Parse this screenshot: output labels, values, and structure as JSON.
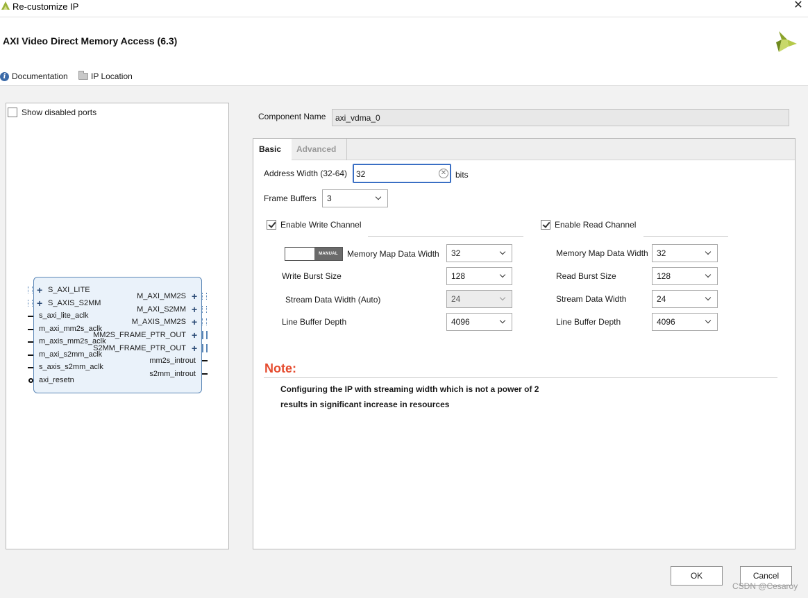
{
  "window": {
    "title": "Re-customize IP",
    "close_glyph": "✕"
  },
  "header": {
    "ip_title": "AXI Video Direct Memory Access (6.3)",
    "doc_label": "Documentation",
    "ip_location_label": "IP Location",
    "info_glyph": "i"
  },
  "left_panel": {
    "show_disabled_label": "Show disabled ports",
    "show_disabled_checked": false,
    "block": {
      "left_ports": [
        "S_AXI_LITE",
        "S_AXIS_S2MM",
        "s_axi_lite_aclk",
        "m_axi_mm2s_aclk",
        "m_axis_mm2s_aclk",
        "m_axi_s2mm_aclk",
        "s_axis_s2mm_aclk",
        "axi_resetn"
      ],
      "right_ports": [
        "M_AXI_MM2S",
        "M_AXI_S2MM",
        "M_AXIS_MM2S",
        "MM2S_FRAME_PTR_OUT",
        "S2MM_FRAME_PTR_OUT",
        "mm2s_introut",
        "s2mm_introut"
      ],
      "plus_glyph": "+"
    }
  },
  "component": {
    "label": "Component Name",
    "value": "axi_vdma_0"
  },
  "tabs": {
    "basic": "Basic",
    "advanced": "Advanced"
  },
  "basic": {
    "address_width_label": "Address Width (32-64)",
    "address_width_value": "32",
    "address_width_unit": "bits",
    "clear_glyph": "✕",
    "frame_buffers_label": "Frame Buffers",
    "frame_buffers_value": "3",
    "write": {
      "enable_label": "Enable Write Channel",
      "enabled": true,
      "manual_label": "MANUAL",
      "mm_width_label": "Memory Map Data Width",
      "mm_width_value": "32",
      "burst_label": "Write Burst Size",
      "burst_value": "128",
      "stream_label": "Stream Data Width (Auto)",
      "stream_value": "24",
      "line_buffer_label": "Line Buffer Depth",
      "line_buffer_value": "4096"
    },
    "read": {
      "enable_label": "Enable Read Channel",
      "enabled": true,
      "mm_width_label": "Memory Map Data Width",
      "mm_width_value": "32",
      "burst_label": "Read Burst Size",
      "burst_value": "128",
      "stream_label": "Stream Data Width",
      "stream_value": "24",
      "line_buffer_label": "Line Buffer Depth",
      "line_buffer_value": "4096"
    }
  },
  "note": {
    "title": "Note:",
    "line1": "Configuring the IP with streaming width which is not a power of 2",
    "line2": "results in significant increase in resources"
  },
  "buttons": {
    "ok": "OK",
    "cancel": "Cancel"
  },
  "watermark": "CSDN @Cesaroy",
  "colors": {
    "accent_blue": "#3a6fc4",
    "note_red": "#e54b2e",
    "block_fill": "#eaf2fa",
    "block_border": "#5a86b6",
    "brand_green": "#9bb33a"
  }
}
